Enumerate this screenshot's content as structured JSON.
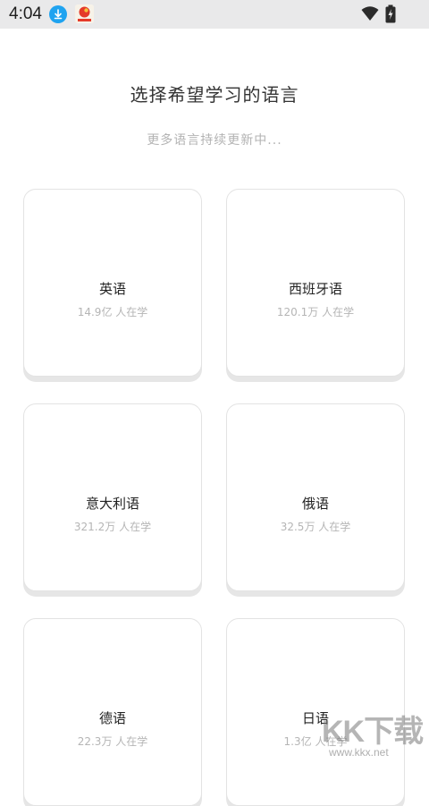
{
  "status_bar": {
    "time": "4:04",
    "icons": [
      "download-icon",
      "app-notification-icon",
      "wifi-icon",
      "battery-charging-icon"
    ]
  },
  "header": {
    "title": "选择希望学习的语言",
    "subtitle": "更多语言持续更新中..."
  },
  "languages": [
    {
      "name": "英语",
      "learners": "14.9亿 人在学"
    },
    {
      "name": "西班牙语",
      "learners": "120.1万 人在学"
    },
    {
      "name": "意大利语",
      "learners": "321.2万 人在学"
    },
    {
      "name": "俄语",
      "learners": "32.5万 人在学"
    },
    {
      "name": "德语",
      "learners": "22.3万 人在学"
    },
    {
      "name": "日语",
      "learners": "1.3亿 人在学"
    }
  ],
  "watermark": {
    "big": "KK下载",
    "small": "www.kkx.net"
  }
}
